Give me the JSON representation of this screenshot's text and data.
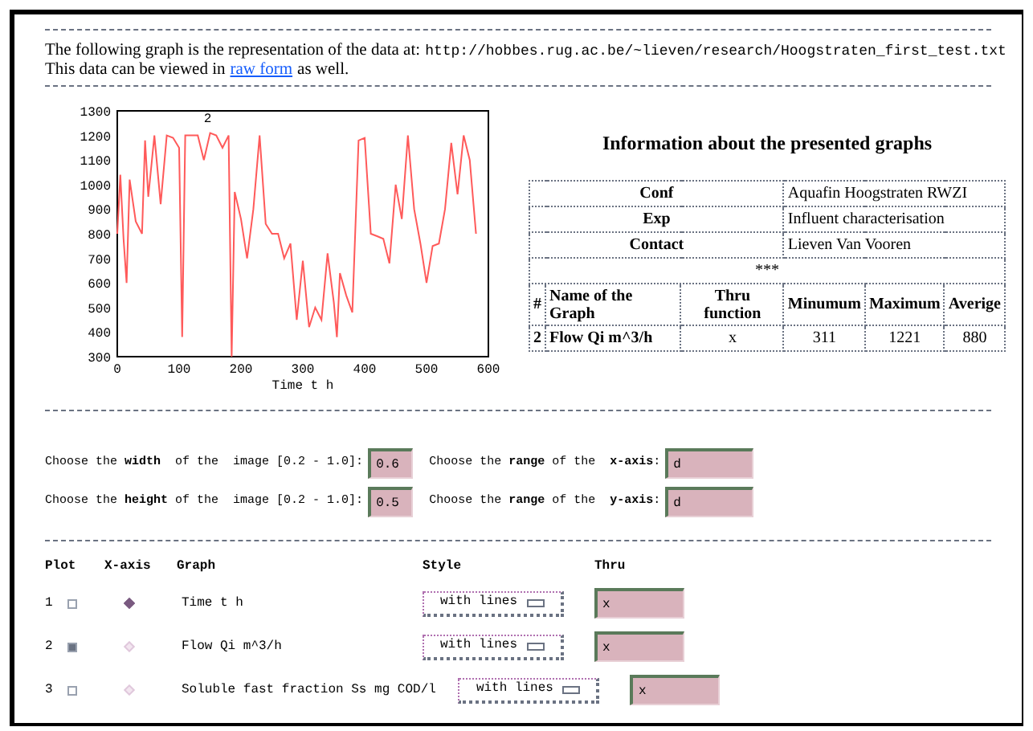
{
  "intro": {
    "text": "The following graph is the representation of the data at:",
    "url": "http://hobbes.rug.ac.be/~lieven/research/Hoogstraten_first_test.txt",
    "before_link": "This data can be viewed in",
    "link": "raw form",
    "after_link": "as well."
  },
  "chart": {
    "chart_data": {
      "type": "line",
      "xlabel": "Time t h",
      "xlim": [
        0,
        600
      ],
      "ylim": [
        300,
        1300
      ],
      "xticks": [
        0,
        100,
        200,
        300,
        400,
        500,
        600
      ],
      "yticks": [
        300,
        400,
        500,
        600,
        700,
        800,
        900,
        1000,
        1100,
        1200,
        1300
      ],
      "x": [
        0,
        5,
        10,
        15,
        20,
        30,
        40,
        45,
        50,
        60,
        70,
        80,
        90,
        100,
        105,
        110,
        120,
        130,
        140,
        150,
        160,
        170,
        180,
        185,
        190,
        200,
        210,
        220,
        230,
        240,
        250,
        260,
        270,
        280,
        290,
        300,
        310,
        320,
        330,
        340,
        350,
        355,
        360,
        370,
        380,
        390,
        400,
        410,
        420,
        430,
        440,
        450,
        460,
        470,
        480,
        490,
        500,
        510,
        520,
        530,
        540,
        550,
        560,
        570,
        580
      ],
      "series": [
        {
          "name": "2",
          "color": "#ff5a5a",
          "values": [
            800,
            1040,
            780,
            600,
            1020,
            850,
            800,
            1180,
            950,
            1200,
            920,
            1200,
            1190,
            1150,
            380,
            1200,
            1200,
            1200,
            1100,
            1210,
            1200,
            1150,
            1200,
            300,
            970,
            860,
            700,
            900,
            1200,
            840,
            800,
            800,
            700,
            760,
            450,
            690,
            420,
            500,
            450,
            720,
            520,
            380,
            640,
            550,
            480,
            1180,
            1190,
            800,
            790,
            780,
            680,
            1000,
            860,
            1200,
            900,
            760,
            600,
            750,
            760,
            900,
            1170,
            960,
            1200,
            1100,
            800
          ]
        }
      ]
    }
  },
  "info": {
    "title": "Information about the presented graphs",
    "meta": [
      {
        "label": "Conf",
        "value": "Aquafin Hoogstraten RWZI"
      },
      {
        "label": "Exp",
        "value": "Influent characterisation"
      },
      {
        "label": "Contact",
        "value": "Lieven Van Vooren"
      }
    ],
    "separator": "***",
    "columns": [
      "#",
      "Name of the Graph",
      "Thru function",
      "Minumum",
      "Maximum",
      "Averige"
    ],
    "rows": [
      [
        "2",
        "Flow Qi m^3/h",
        "x",
        "311",
        "1221",
        "880"
      ]
    ]
  },
  "image_settings": [
    {
      "size_label": "Choose the **width**  of the  image [0.2 - 1.0]:",
      "size_value": "0.6",
      "range_label": "Choose the **range** of the  **x-axis**:",
      "range_value": "d"
    },
    {
      "size_label": "Choose the **height** of the  image [0.2 - 1.0]:",
      "size_value": "0.5",
      "range_label": "Choose the **range** of the  **y-axis**:",
      "range_value": "d"
    }
  ],
  "plots": {
    "columns": [
      "Plot",
      "X-axis",
      "Graph",
      "Style",
      "Thru"
    ],
    "rows": [
      {
        "number": "1",
        "checked": false,
        "selected": true,
        "graph": "Time t h",
        "style": "with lines",
        "thru": "x"
      },
      {
        "number": "2",
        "checked": true,
        "selected": false,
        "graph": "Flow Qi m^3/h",
        "style": "with lines",
        "thru": "x"
      },
      {
        "number": "3",
        "checked": false,
        "selected": false,
        "graph": "Soluble fast fraction Ss mg COD/l",
        "style": "with lines",
        "thru": "x"
      }
    ]
  }
}
